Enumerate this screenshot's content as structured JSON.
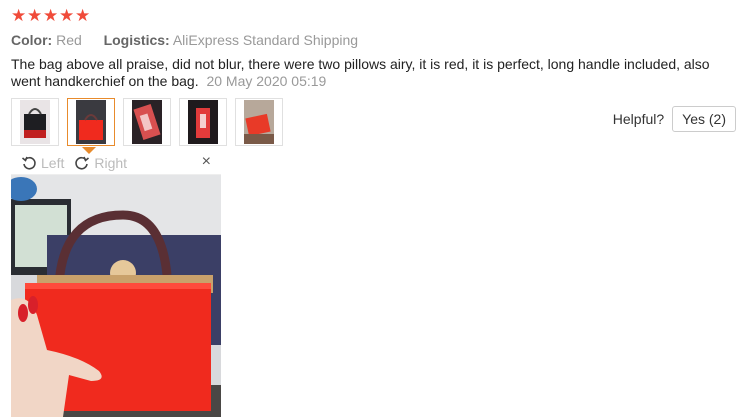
{
  "rating": {
    "stars": [
      "★",
      "★",
      "★",
      "★",
      "★"
    ],
    "color": "#f04b3a"
  },
  "meta": {
    "color_label": "Color:",
    "color_value": "Red",
    "logistics_label": "Logistics:",
    "logistics_value": "AliExpress Standard Shipping"
  },
  "review": {
    "text": "The bag above all praise, did not blur, there were two pillows airy, it is red, it is perfect, long handle included, also went handkerchief on the bag.",
    "date": "20 May 2020 05:19"
  },
  "thumbnails": [
    {
      "name": "photo-1"
    },
    {
      "name": "photo-2",
      "active": true
    },
    {
      "name": "photo-3"
    },
    {
      "name": "photo-4"
    },
    {
      "name": "photo-5"
    }
  ],
  "helpful": {
    "label": "Helpful?",
    "yes_label": "Yes (2)"
  },
  "viewer": {
    "left_label": "Left",
    "right_label": "Right",
    "close_glyph": "×"
  },
  "colors": {
    "accent": "#e88b2c",
    "bag_red": "#f02a1e"
  }
}
